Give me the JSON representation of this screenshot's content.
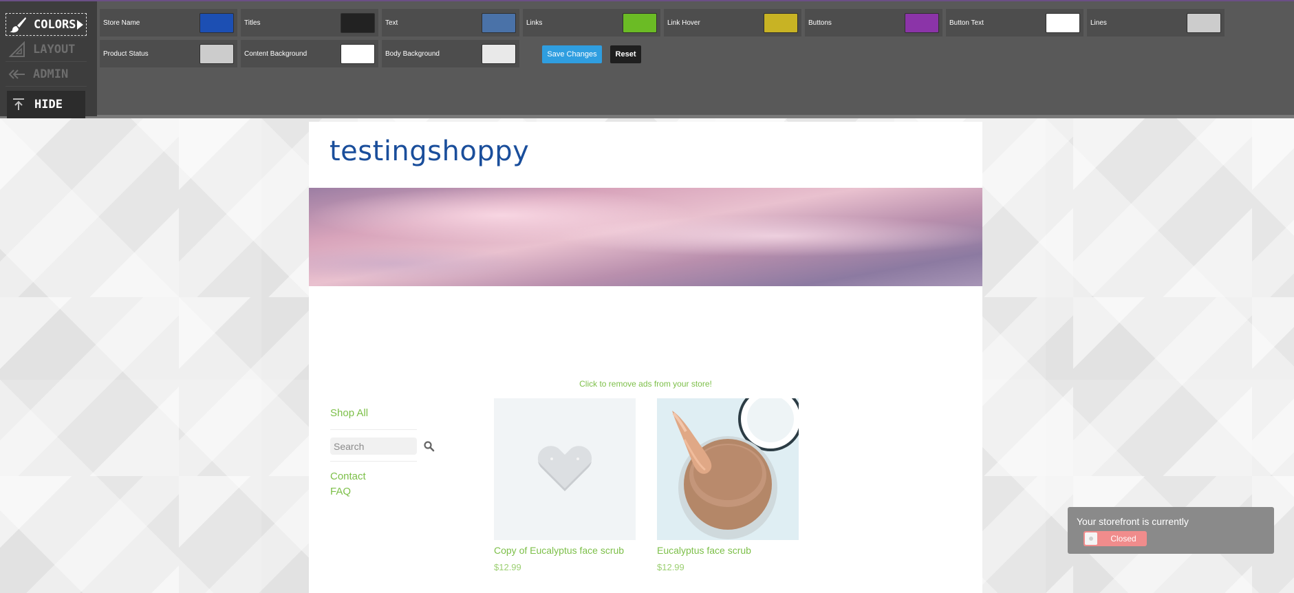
{
  "editor": {
    "nav": {
      "colors": "COLORS",
      "layout": "LAYOUT",
      "admin": "ADMIN",
      "hide": "HIDE"
    },
    "fields": [
      {
        "label": "Store Name",
        "color": "#1c4fb3"
      },
      {
        "label": "Titles",
        "color": "#222222"
      },
      {
        "label": "Text",
        "color": "#4a72a8"
      },
      {
        "label": "Links",
        "color": "#6bbb25"
      },
      {
        "label": "Link Hover",
        "color": "#c8b324"
      },
      {
        "label": "Buttons",
        "color": "#8b34a8"
      },
      {
        "label": "Button Text",
        "color": "#ffffff"
      },
      {
        "label": "Lines",
        "color": "#cccccc"
      },
      {
        "label": "Product Status",
        "color": "#cccccc"
      },
      {
        "label": "Content Background",
        "color": "#ffffff"
      },
      {
        "label": "Body Background",
        "color": "#e9e9e9"
      }
    ],
    "save_label": "Save Changes",
    "reset_label": "Reset"
  },
  "store": {
    "name": "testingshoppy",
    "ad_text": "Click to remove ads from your store!",
    "sidebar": {
      "shop_all": "Shop All",
      "search_placeholder": "Search",
      "contact": "Contact",
      "faq": "FAQ"
    },
    "products": [
      {
        "name": "Copy of Eucalyptus face scrub",
        "price": "$12.99"
      },
      {
        "name": "Eucalyptus face scrub",
        "price": "$12.99"
      }
    ]
  },
  "status": {
    "text": "Your storefront is currently",
    "toggle_label": "Closed"
  }
}
